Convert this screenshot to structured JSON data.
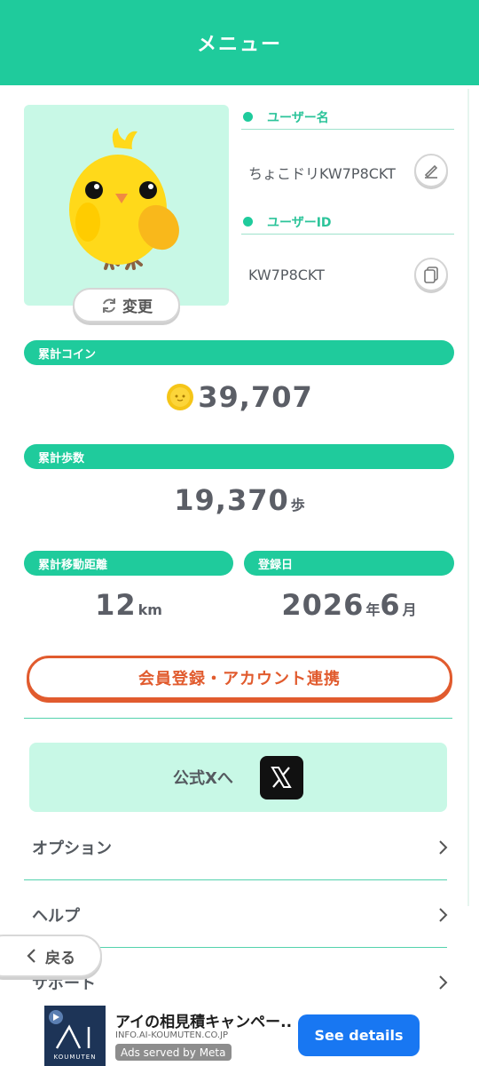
{
  "header": {
    "title": "メニュー"
  },
  "profile": {
    "change_label": "変更",
    "username_label": "ユーザー名",
    "username": "ちょこドリKW7P8CKT",
    "userid_label": "ユーザーID",
    "userid": "KW7P8CKT"
  },
  "stats": {
    "coins_label": "累計コイン",
    "coins_value": "39,707",
    "steps_label": "累計歩数",
    "steps_value": "19,370",
    "steps_unit": "歩",
    "distance_label": "累計移動距離",
    "distance_value": "12",
    "distance_unit": "km",
    "registered_label": "登録日",
    "registered_year": "2026",
    "registered_year_unit": "年",
    "registered_month": "6",
    "registered_month_unit": "月"
  },
  "register_button": "会員登録・アカウント連携",
  "official_x": {
    "label": "公式Xへ"
  },
  "menu": {
    "items": [
      {
        "label": "オプション"
      },
      {
        "label": "ヘルプ"
      },
      {
        "label": "サポート"
      }
    ]
  },
  "back_button": "戻る",
  "ad": {
    "logo_text": "KOUMUTEN",
    "title": "アイの相見積キャンペー...",
    "url": "INFO.AI-KOUMUTEN.CO.JP",
    "badge": "Ads served by Meta",
    "cta": "See details"
  },
  "colors": {
    "primary": "#1fcb9c",
    "light_mint": "#c8f8e6",
    "accent_orange": "#e15b2e",
    "cta_blue": "#1877f2"
  }
}
